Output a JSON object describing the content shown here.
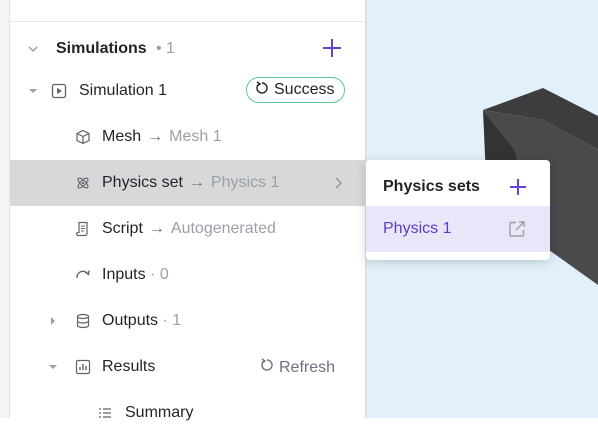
{
  "section": {
    "title": "Simulations",
    "count": "• 1"
  },
  "simulation": {
    "name": "Simulation 1",
    "status": "Success"
  },
  "items": {
    "mesh": {
      "label": "Mesh",
      "target": "Mesh 1"
    },
    "physics": {
      "label": "Physics set",
      "target": "Physics 1"
    },
    "script": {
      "label": "Script",
      "target": "Autogenerated"
    },
    "inputs": {
      "label": "Inputs",
      "count": "· 0"
    },
    "outputs": {
      "label": "Outputs",
      "count": "· 1"
    },
    "results": {
      "label": "Results",
      "action": "Refresh"
    },
    "summary": {
      "label": "Summary"
    }
  },
  "popup": {
    "title": "Physics sets",
    "items": [
      "Physics 1"
    ]
  },
  "colors": {
    "accent": "#6a3fd6",
    "success_border": "#58c99a",
    "viewport_bg": "#e1f0fb",
    "highlight": "#d7d8da"
  },
  "icons": [
    "chevron-down-icon",
    "chevron-right-icon",
    "play-square-icon",
    "cube-icon",
    "atom-icon",
    "script-icon",
    "redo-arrow-icon",
    "database-icon",
    "bar-chart-icon",
    "list-icon",
    "refresh-icon",
    "plus-icon",
    "external-link-icon"
  ]
}
